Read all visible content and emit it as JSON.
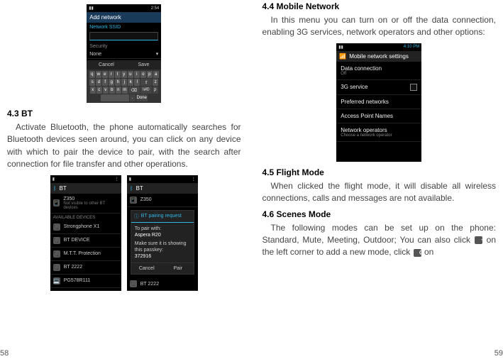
{
  "left": {
    "pagenum": "58",
    "section43_heading": "4.3 BT",
    "section43_body": "Activate Bluetooth, the phone automatically searches for Bluetooth devices seen around, you can click on any device with which to pair the device to pair, with the search after connection for file transfer and other operations.",
    "addnet": {
      "statusbar_time": "2:54",
      "title": "Add network",
      "ssid_label": "Network SSID",
      "ssid_placeholder": "",
      "security_label": "Security",
      "security_value": "None",
      "cancel": "Cancel",
      "save": "Save",
      "keys_row1": [
        "q",
        "w",
        "e",
        "r",
        "t",
        "y",
        "u",
        "i",
        "o",
        "p"
      ],
      "keys_row2": [
        "a",
        "s",
        "d",
        "f",
        "g",
        "h",
        "j",
        "k",
        "l"
      ],
      "keys_row3": [
        "⇧",
        "z",
        "x",
        "c",
        "v",
        "b",
        "n",
        "m",
        "⌫"
      ],
      "keys_row4_sym": "!#©",
      "keys_row4_lang": "ק",
      "keys_row4_done": "Done"
    },
    "bt_list": {
      "title": "BT",
      "device_main": "Z350",
      "device_sub": "Not visible to other BT devices",
      "avail_label": "AVAILABLE DEVICES",
      "items": [
        "Strongphone X1",
        "BT DEVICE",
        "M.T.T. Protection",
        "BT 2222",
        "PG578R111"
      ]
    },
    "bt_pair": {
      "title": "BT",
      "device": "Z350",
      "dialog_title": "BT pairing request",
      "to_pair": "To pair with:",
      "pair_name": "Aspera R20",
      "instr1": "Make sure it is showing this passkey:",
      "passkey": "372916",
      "cancel": "Cancel",
      "pair": "Pair",
      "other": "BT 2222"
    }
  },
  "right": {
    "pagenum": "59",
    "section44_heading": "4.4 Mobile Network",
    "section44_body": "In this menu you can turn on or off the data connection, enabling 3G services, network operators and other options:",
    "mobilenet": {
      "statusbar_time": "4:10 PM",
      "title": "Mobile network settings",
      "items": [
        {
          "main": "Data connection",
          "sub": "Off"
        },
        {
          "main": "3G service",
          "sub": ""
        },
        {
          "main": "Preferred networks",
          "sub": ""
        },
        {
          "main": "Access Point Names",
          "sub": ""
        },
        {
          "main": "Network operators",
          "sub": "Choose a network operator"
        }
      ]
    },
    "section45_heading": "4.5 Flight Mode",
    "section45_body": "When clicked the flight mode, it will disable all wireless connections, calls and messages are not available.",
    "section46_heading": "4.6 Scenes Mode",
    "section46_body_1": "The following modes can be set up on the phone: Standard, Mute, Meeting, Outdoor; You can also click ",
    "section46_body_2": " on the left corner to add a new mode, click ",
    "section46_body_3": " on",
    "plus_icon_label": "plus-icon",
    "gear_icon_label": "gear-icon"
  }
}
